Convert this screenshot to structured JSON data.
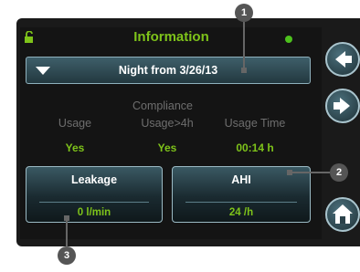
{
  "header": {
    "title": "Information"
  },
  "date_selector": {
    "label": "Night from 3/26/13"
  },
  "compliance": {
    "title": "Compliance",
    "columns": [
      {
        "header": "Usage",
        "value": "Yes"
      },
      {
        "header": "Usage>4h",
        "value": "Yes"
      },
      {
        "header": "Usage Time",
        "value": "00:14 h"
      }
    ]
  },
  "cards": {
    "leakage": {
      "title": "Leakage",
      "value": "0 l/min"
    },
    "ahi": {
      "title": "AHI",
      "value": "24 /h"
    }
  },
  "nav_buttons": [
    "back-arrow-icon",
    "forward-arrow-icon",
    "home-icon"
  ],
  "callouts": [
    "1",
    "2",
    "3"
  ],
  "colors": {
    "accent_green": "#7ec31a",
    "status_dot": "#4dc11d",
    "button_blue": "#3e5f6a"
  }
}
